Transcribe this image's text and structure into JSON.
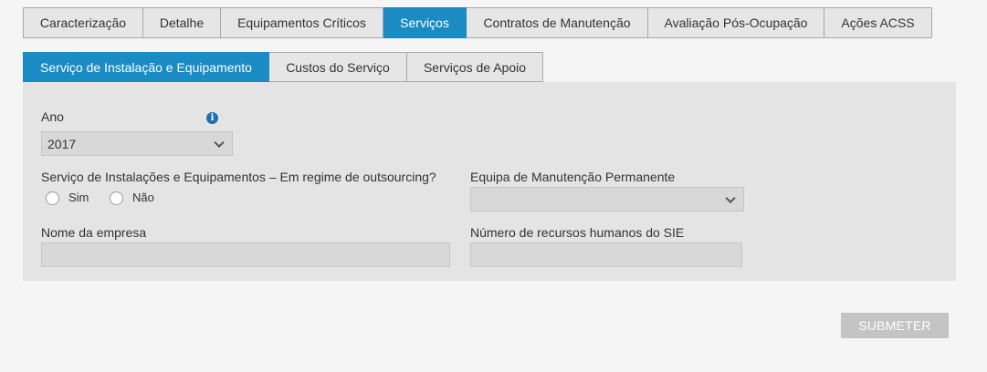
{
  "main_tabs": [
    {
      "label": "Caracterização"
    },
    {
      "label": "Detalhe"
    },
    {
      "label": "Equipamentos Críticos"
    },
    {
      "label": "Serviços",
      "active": true
    },
    {
      "label": "Contratos de Manutenção"
    },
    {
      "label": "Avaliação Pós-Ocupação"
    },
    {
      "label": "Ações ACSS"
    }
  ],
  "sub_tabs": [
    {
      "label": "Serviço de Instalação e Equipamento",
      "active": true
    },
    {
      "label": "Custos do Serviço"
    },
    {
      "label": "Serviços de Apoio"
    }
  ],
  "form": {
    "ano_label": "Ano",
    "ano_value": "2017",
    "outsourcing_label": "Serviço de Instalações e Equipamentos – Em regime de outsourcing?",
    "option_sim": "Sim",
    "option_nao": "Não",
    "equipa_label": "Equipa de Manutenção Permanente",
    "equipa_value": "",
    "nome_empresa_label": "Nome da empresa",
    "nome_empresa_value": "",
    "recursos_label": "Número de recursos humanos do SIE",
    "recursos_value": ""
  },
  "submit_label": "SUBMETER",
  "icons": {
    "info": "info-icon",
    "dropdown": "chevron-down-icon"
  },
  "colors": {
    "accent": "#1a8bc3",
    "panel": "#e4e4e4",
    "info": "#1f6fb4",
    "submit_disabled": "#c4c4c4"
  }
}
